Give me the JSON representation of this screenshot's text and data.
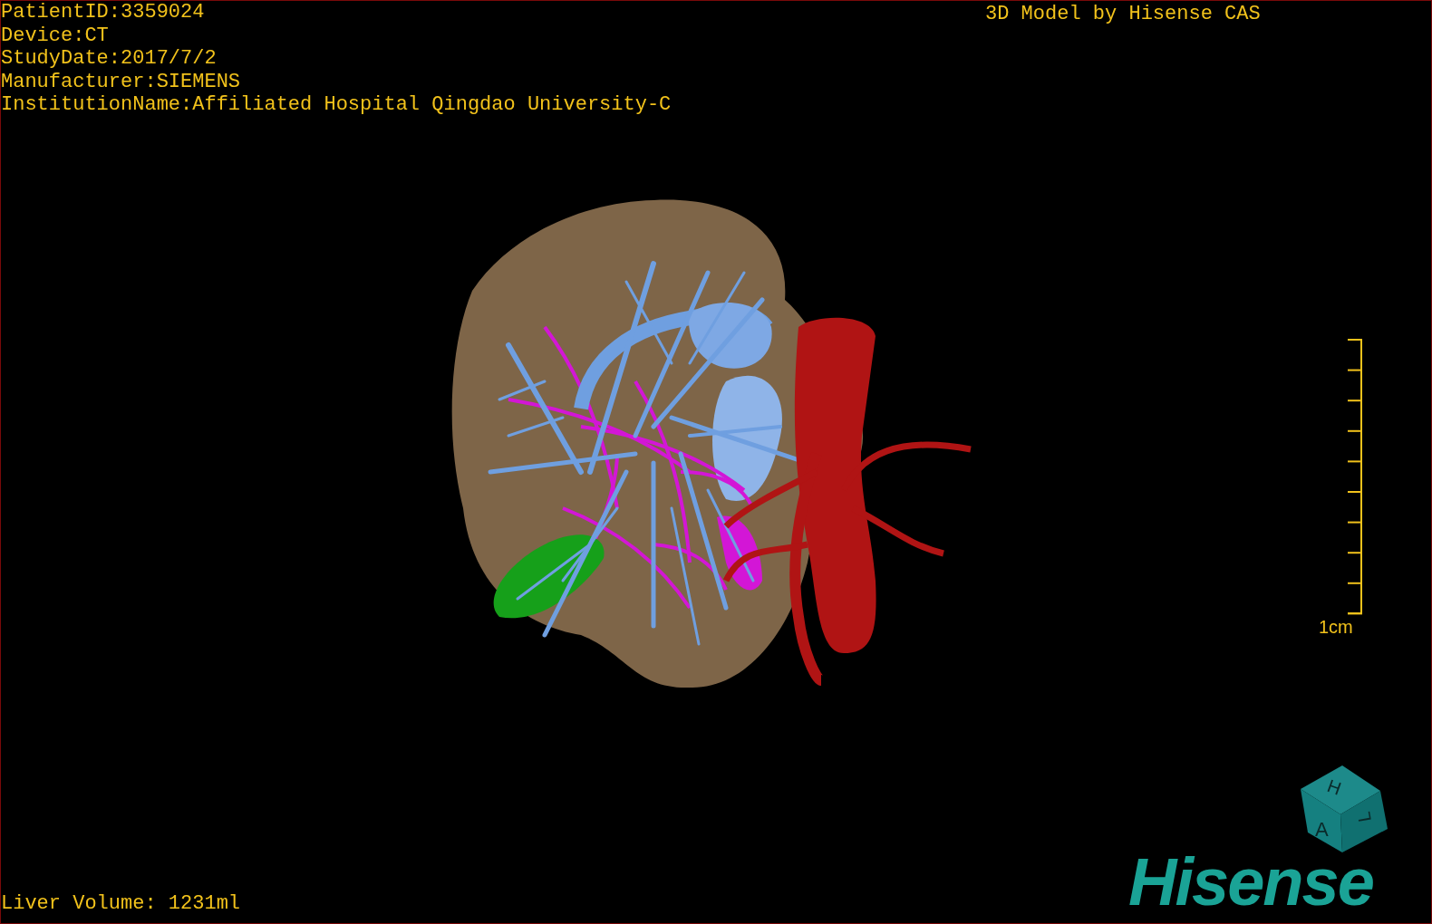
{
  "info_lines": [
    "PatientID:3359024",
    "Device:CT",
    "StudyDate:2017/7/2",
    "Manufacturer:SIEMENS",
    "InstitutionName:Affiliated Hospital Qingdao University-C"
  ],
  "credit": "3D Model by Hisense CAS",
  "scale_bar": {
    "label": "1cm"
  },
  "orientation_cube": {
    "faces": [
      "H",
      "A",
      "L"
    ]
  },
  "liver_volume": "Liver Volume: 1231ml",
  "logo": "Hisense"
}
